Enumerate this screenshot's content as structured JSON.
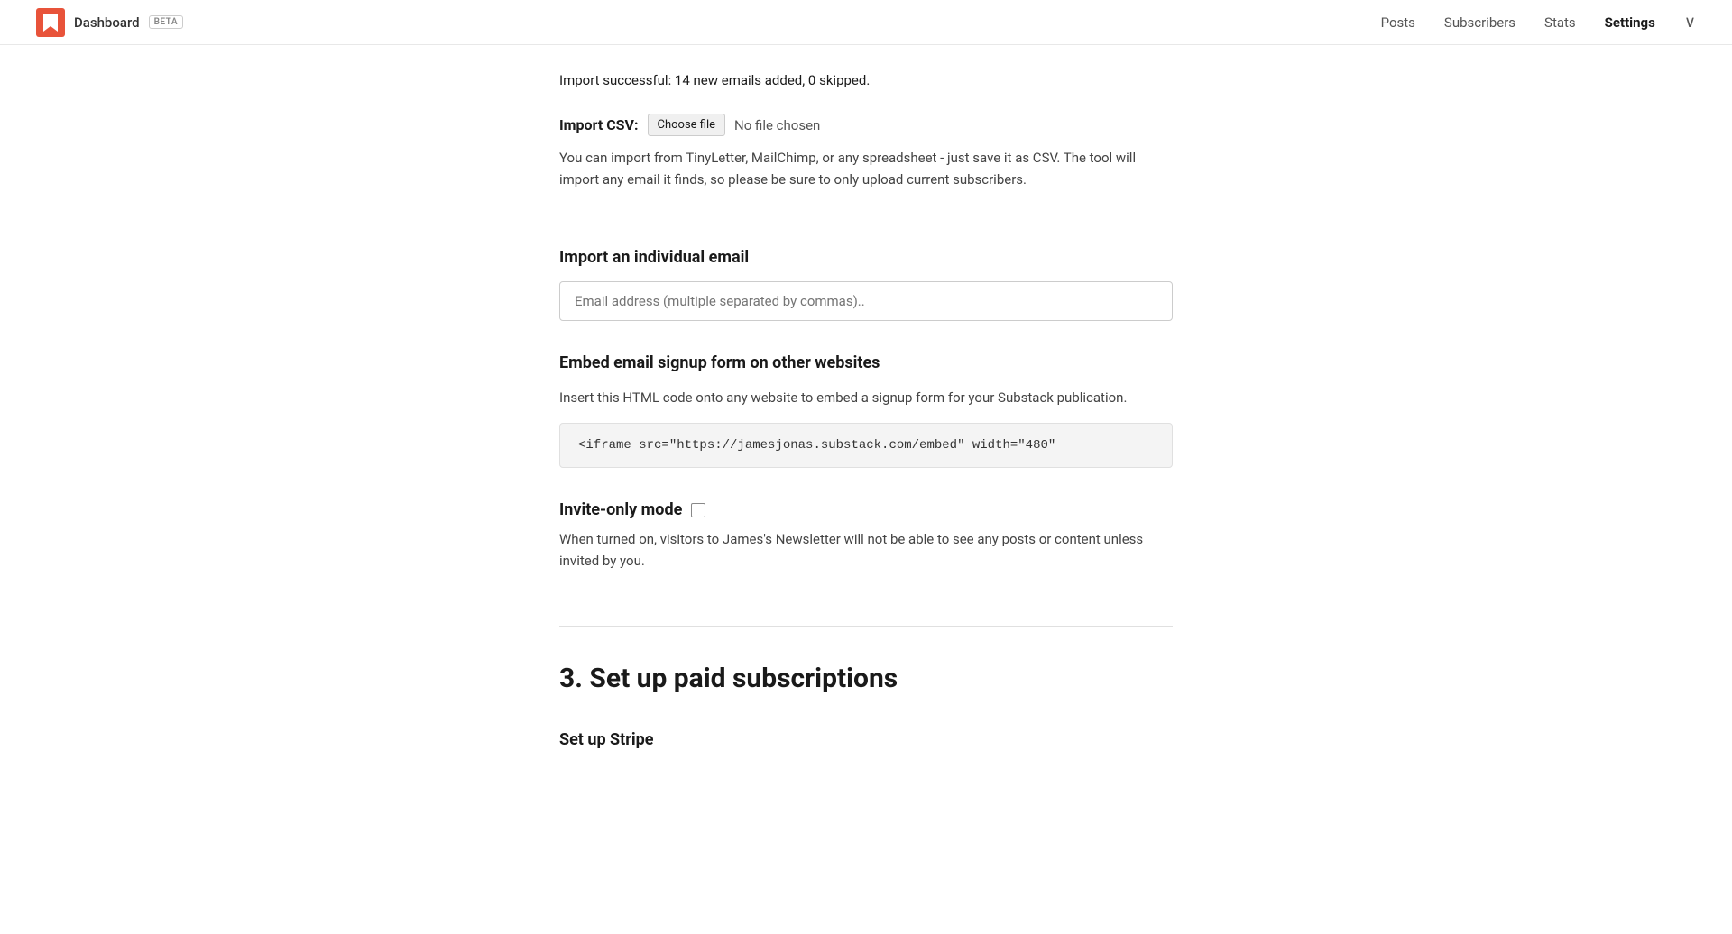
{
  "header": {
    "brand": "Dashboard",
    "beta_label": "BETA",
    "nav": [
      {
        "label": "Posts",
        "active": false
      },
      {
        "label": "Subscribers",
        "active": false
      },
      {
        "label": "Stats",
        "active": false
      },
      {
        "label": "Settings",
        "active": true
      }
    ],
    "chevron": "∨"
  },
  "main": {
    "success_message": "Import successful: 14 new emails added, 0 skipped.",
    "import_csv": {
      "label": "Import CSV:",
      "choose_file_btn": "Choose file",
      "no_file_text": "No file chosen",
      "description": "You can import from TinyLetter, MailChimp, or any spreadsheet - just save it as CSV. The tool will import any email it finds, so please be sure to only upload current subscribers."
    },
    "import_email": {
      "title": "Import an individual email",
      "placeholder": "Email address (multiple separated by commas).."
    },
    "embed": {
      "title": "Embed email signup form on other websites",
      "description": "Insert this HTML code onto any website to embed a signup form for your Substack publication.",
      "code": "<iframe src=\"https://jamesjonas.substack.com/embed\" width=\"480\""
    },
    "invite_only": {
      "title": "Invite-only mode",
      "description": "When turned on, visitors to James's Newsletter will not be able to see any posts or content unless invited by you.",
      "checked": false
    },
    "paid_subscriptions": {
      "section_number": "3.",
      "title": "Set up paid subscriptions",
      "setup_stripe": {
        "label": "Set up Stripe"
      }
    }
  }
}
